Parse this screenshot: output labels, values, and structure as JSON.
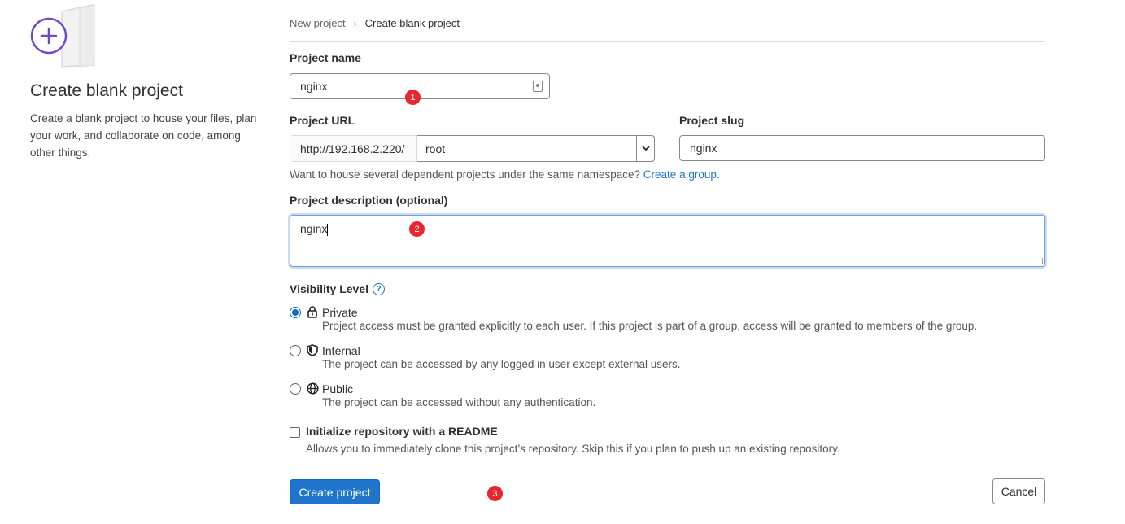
{
  "left_panel": {
    "title": "Create blank project",
    "description": "Create a blank project to house your files, plan your work, and collaborate on code, among other things."
  },
  "breadcrumb": {
    "parent": "New project",
    "current": "Create blank project"
  },
  "project_name": {
    "label": "Project name",
    "value": "nginx"
  },
  "project_url": {
    "label": "Project URL",
    "prefix": "http://192.168.2.220/",
    "namespace": "root"
  },
  "project_slug": {
    "label": "Project slug",
    "value": "nginx"
  },
  "help_text": {
    "text": "Want to house several dependent projects under the same namespace?",
    "link": "Create a group."
  },
  "description": {
    "label": "Project description (optional)",
    "value": "nginx"
  },
  "visibility": {
    "label": "Visibility Level",
    "help_icon": "?",
    "options": [
      {
        "label": "Private",
        "desc": "Project access must be granted explicitly to each user. If this project is part of a group, access will be granted to members of the group.",
        "icon": "lock-icon",
        "checked": true
      },
      {
        "label": "Internal",
        "desc": "The project can be accessed by any logged in user except external users.",
        "icon": "shield-icon",
        "checked": false
      },
      {
        "label": "Public",
        "desc": "The project can be accessed without any authentication.",
        "icon": "globe-icon",
        "checked": false
      }
    ]
  },
  "readme": {
    "label": "Initialize repository with a README",
    "desc": "Allows you to immediately clone this project’s repository. Skip this if you plan to push up an existing repository.",
    "checked": false
  },
  "buttons": {
    "create": "Create project",
    "cancel": "Cancel"
  },
  "annotations": [
    "1",
    "2",
    "3"
  ],
  "colors": {
    "primary": "#1f75cb",
    "illustration": "#6e49cb",
    "annotation_badge": "#e8262c"
  }
}
